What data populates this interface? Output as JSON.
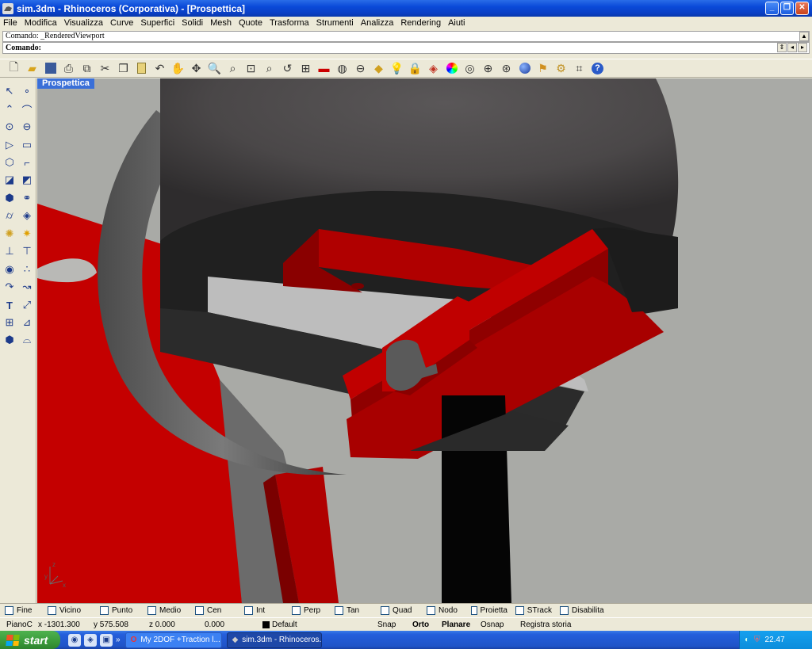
{
  "window": {
    "title": "sim.3dm - Rhinoceros (Corporativa) - [Prospettica]",
    "minimize": "_",
    "restore": "❐",
    "close": "✕"
  },
  "menu": [
    "File",
    "Modifica",
    "Visualizza",
    "Curve",
    "Superfici",
    "Solidi",
    "Mesh",
    "Quote",
    "Trasforma",
    "Strumenti",
    "Analizza",
    "Rendering",
    "Aiuti"
  ],
  "command": {
    "history": "Comando: _RenderedViewport",
    "prompt": "Comando:"
  },
  "viewport": {
    "label": "Prospettica",
    "axis_x": "x",
    "axis_y": "y",
    "axis_z": "z",
    "colors": {
      "background": "#a9aaa6",
      "red": "#c80000",
      "dark": "#222222",
      "gray": "#6e6e6e"
    }
  },
  "top_toolbar_icons": [
    "new-file-icon",
    "open-icon",
    "save-icon",
    "print-icon",
    "import-icon",
    "cut-icon",
    "copy-icon",
    "paste-icon",
    "undo-icon",
    "pan-icon",
    "rotate-view-icon",
    "zoom-window-icon",
    "zoom-dynamic-icon",
    "zoom-extents-icon",
    "zoom-selected-icon",
    "undo-view-icon",
    "four-viewports-icon",
    "car-render-icon",
    "shaded-icon",
    "rendered-icon",
    "layers-icon",
    "light-icon",
    "lock-icon",
    "material-icon",
    "color-wheel-icon",
    "globe-icon",
    "sphere-icon",
    "render-sphere-icon",
    "options-icon",
    "plugin-icon",
    "grid-icon",
    "help-icon"
  ],
  "osnaps": [
    "Fine",
    "Vicino",
    "Punto",
    "Medio",
    "Cen",
    "Int",
    "Perp",
    "Tan",
    "Quad",
    "Nodo",
    "Proietta",
    "STrack",
    "Disabilita"
  ],
  "status": {
    "cplane": "PianoC",
    "x": "x -1301.300",
    "y": "y 575.508",
    "z": "z 0.000",
    "extra": "0.000",
    "layer": "Default",
    "snap": "Snap",
    "ortho": "Orto",
    "planar": "Planare",
    "osnap": "Osnap",
    "history": "Registra storia"
  },
  "taskbar": {
    "start": "start",
    "tasks": [
      "My 2DOF +Traction l...",
      "sim.3dm - Rhinoceros..."
    ],
    "lang": "IT",
    "clock": "22.47"
  }
}
